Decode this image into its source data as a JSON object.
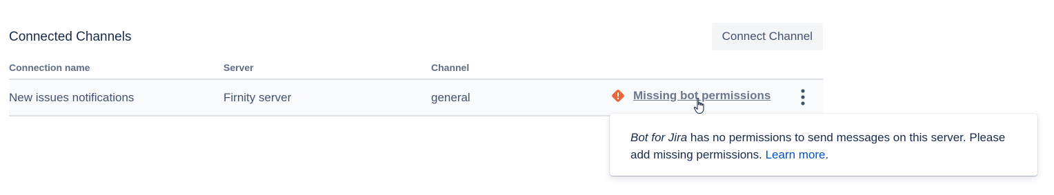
{
  "header": {
    "title": "Connected Channels",
    "connect_button": "Connect Channel"
  },
  "table": {
    "columns": [
      "Connection name",
      "Server",
      "Channel"
    ],
    "rows": [
      {
        "name": "New issues notifications",
        "server": "Firnity server",
        "channel": "general",
        "status": "Missing bot permissions"
      }
    ]
  },
  "tooltip": {
    "bot_name": "Bot for Jira",
    "message": " has no permissions to send messages on this server. Please add missing permissions. ",
    "link": "Learn more",
    "trailing": "."
  },
  "icons": {
    "status": "warning-diamond-icon",
    "more": "more-vertical-icon",
    "cursor": "hand-pointer-icon"
  },
  "colors": {
    "warning": "#e5683b",
    "link": "#0052cc",
    "text": "#172b4d"
  }
}
